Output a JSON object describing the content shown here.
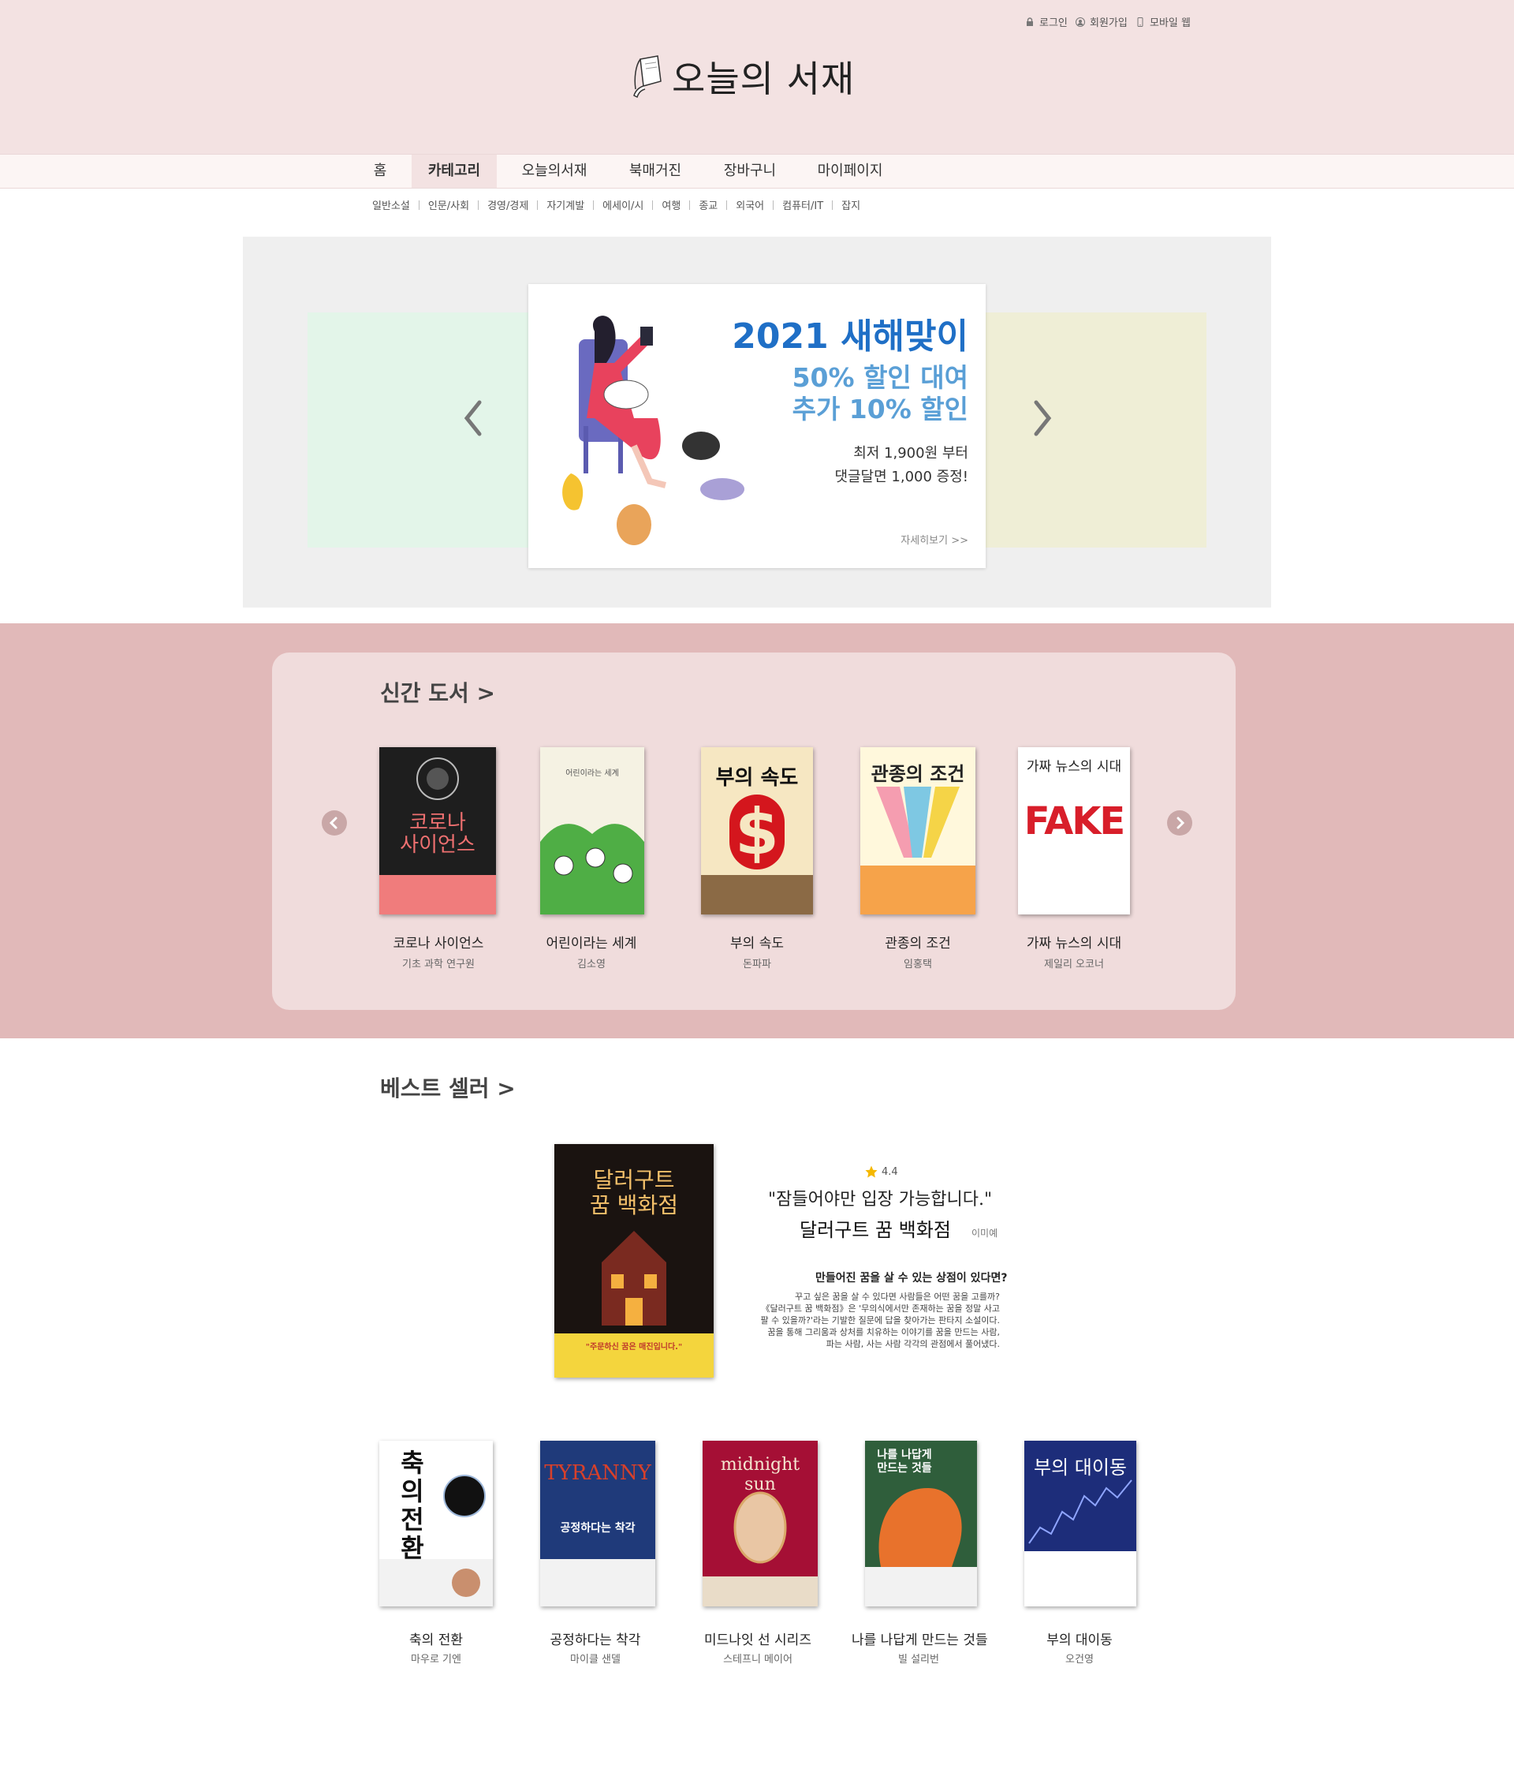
{
  "header": {
    "util_links": [
      {
        "label": "로그인",
        "icon": "lock-icon"
      },
      {
        "label": "회원가입",
        "icon": "user-icon"
      },
      {
        "label": "모바일 웹",
        "icon": "mobile-icon"
      }
    ],
    "logo_text": "오늘의 서재",
    "logo_icon": "book-logo-icon"
  },
  "nav": {
    "items": [
      "홈",
      "카테고리",
      "오늘의서재",
      "북매거진",
      "장바구니",
      "마이페이지"
    ],
    "active": "카테고리"
  },
  "subnav": {
    "items": [
      "일반소설",
      "인문/사회",
      "경영/경제",
      "자기계발",
      "에세이/시",
      "여행",
      "종교",
      "외국어",
      "컴퓨터/IT",
      "잡지"
    ]
  },
  "banner": {
    "headline": "2021 새해맞이",
    "sub1": "50% 할인 대여",
    "sub2": "추가 10% 할인",
    "desc1": "최저 1,900원 부터",
    "desc2": "댓글달면 1,000 증정!",
    "more": "자세히보기 >>",
    "colors": {
      "headline": "#1f6fc6",
      "sub": "#5a9fd6",
      "left_panel": "#e3f5e9",
      "right_panel": "#efeed6"
    }
  },
  "new_books": {
    "title": "신간 도서  >",
    "books": [
      {
        "title": "코로나 사이언스",
        "author": "기초 과학 연구원",
        "cover_text": "코로나\n사이언스"
      },
      {
        "title": "어린이라는 세계",
        "author": "김소영",
        "cover_text": "어린이라는 세계"
      },
      {
        "title": "부의 속도",
        "author": "돈파파",
        "cover_text": "부의 속도"
      },
      {
        "title": "관종의 조건",
        "author": "임홍택",
        "cover_text": "관종의 조건"
      },
      {
        "title": "가짜 뉴스의 시대",
        "author": "제일리 오코너",
        "cover_text": "가짜 뉴스의 시대"
      }
    ]
  },
  "bestseller": {
    "title": "베스트 셀러  >",
    "featured": {
      "rating": "4.4",
      "quote": "\"잠들어야만 입장 가능합니다.\"",
      "title": "달러구트 꿈 백화점",
      "author": "이미예",
      "headline": "만들어진 꿈을 살 수 있는 상점이 있다면?",
      "body": [
        "꾸고 싶은 꿈을 살 수 있다면 사람들은 어떤 꿈을 고를까?",
        "《달러구트 꿈 백화점》은 '무의식에서만 존재하는 꿈을 정말 사고",
        "팔 수 있을까?'라는 기발한 질문에 답을 찾아가는 판타지 소설이다.",
        "꿈을 통해 그리움과 상처를 치유하는 이야기를 꿈을 만드는 사람,",
        "파는 사람, 사는 사람 각각의 관점에서 풀어냈다."
      ],
      "cover_text": "달러구트\n꿈 백화점",
      "cover_banner": "\"주문하신 꿈은 매진입니다.\""
    },
    "books": [
      {
        "title": "축의 전환",
        "author": "마우로 기엔",
        "cover_text": "축의\n전환"
      },
      {
        "title": "공정하다는 착각",
        "author": "마이클 샌델",
        "cover_text": "공정하다는 착각"
      },
      {
        "title": "미드나잇 선 시리즈",
        "author": "스테프니 메이어",
        "cover_text": "midnight sun"
      },
      {
        "title": "나를 나답게 만드는 것들",
        "author": "빌 설리번",
        "cover_text": "나를 나답게\n만드는 것들"
      },
      {
        "title": "부의 대이동",
        "author": "오건영",
        "cover_text": "부의 대이동"
      }
    ]
  }
}
